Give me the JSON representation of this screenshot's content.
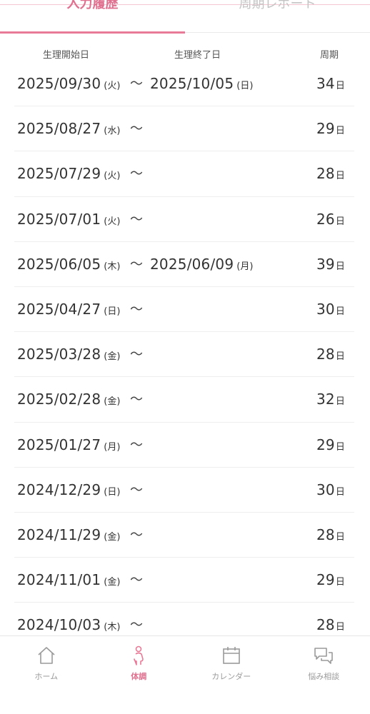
{
  "tabs": [
    {
      "label": "入力履歴",
      "active": true
    },
    {
      "label": "周期レポート",
      "active": false
    }
  ],
  "header": {
    "start": "生理開始日",
    "end": "生理終了日",
    "cycle": "周期"
  },
  "tilde": "〜",
  "cycle_unit": "日",
  "records": [
    {
      "start": "2025/09/30",
      "start_dow": "(火)",
      "end": "2025/10/05",
      "end_dow": "(日)",
      "cycle": "34"
    },
    {
      "start": "2025/08/27",
      "start_dow": "(水)",
      "end": "",
      "end_dow": "",
      "cycle": "29"
    },
    {
      "start": "2025/07/29",
      "start_dow": "(火)",
      "end": "",
      "end_dow": "",
      "cycle": "28"
    },
    {
      "start": "2025/07/01",
      "start_dow": "(火)",
      "end": "",
      "end_dow": "",
      "cycle": "26"
    },
    {
      "start": "2025/06/05",
      "start_dow": "(木)",
      "end": "2025/06/09",
      "end_dow": "(月)",
      "cycle": "39"
    },
    {
      "start": "2025/04/27",
      "start_dow": "(日)",
      "end": "",
      "end_dow": "",
      "cycle": "30"
    },
    {
      "start": "2025/03/28",
      "start_dow": "(金)",
      "end": "",
      "end_dow": "",
      "cycle": "28"
    },
    {
      "start": "2025/02/28",
      "start_dow": "(金)",
      "end": "",
      "end_dow": "",
      "cycle": "32"
    },
    {
      "start": "2025/01/27",
      "start_dow": "(月)",
      "end": "",
      "end_dow": "",
      "cycle": "29"
    },
    {
      "start": "2024/12/29",
      "start_dow": "(日)",
      "end": "",
      "end_dow": "",
      "cycle": "30"
    },
    {
      "start": "2024/11/29",
      "start_dow": "(金)",
      "end": "",
      "end_dow": "",
      "cycle": "28"
    },
    {
      "start": "2024/11/01",
      "start_dow": "(金)",
      "end": "",
      "end_dow": "",
      "cycle": "29"
    },
    {
      "start": "2024/10/03",
      "start_dow": "(木)",
      "end": "",
      "end_dow": "",
      "cycle": "28"
    }
  ],
  "bottom_nav": [
    {
      "label": "ホーム",
      "icon": "home-icon",
      "active": false
    },
    {
      "label": "体調",
      "icon": "body-icon",
      "active": true
    },
    {
      "label": "カレンダー",
      "icon": "calendar-icon",
      "active": false
    },
    {
      "label": "悩み相談",
      "icon": "chat-icon",
      "active": false
    }
  ],
  "colors": {
    "accent": "#e97a97",
    "inactive": "#9a9a9a"
  }
}
